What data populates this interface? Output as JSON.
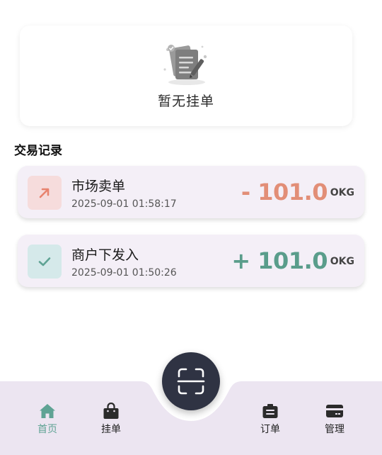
{
  "empty_state": {
    "icon": "document-pen-icon",
    "text": "暂无挂单"
  },
  "section_title": "交易记录",
  "transactions": [
    {
      "title": "市场卖单",
      "time": "2025-09-01 01:58:17",
      "amount": "- 101.0",
      "unit": "OKG",
      "icon": "arrow-up-right-icon",
      "color": "#e28e77"
    },
    {
      "title": "商户下发入",
      "time": "2025-09-01 01:50:26",
      "amount": "+ 101.0",
      "unit": "OKG",
      "icon": "check-icon",
      "color": "#5a9d8b"
    }
  ],
  "nav": {
    "home_label": "首页",
    "orders_label": "挂单",
    "scan_icon": "scan-icon",
    "order_label": "订单",
    "manage_label": "管理",
    "active_color": "#5fa394"
  }
}
